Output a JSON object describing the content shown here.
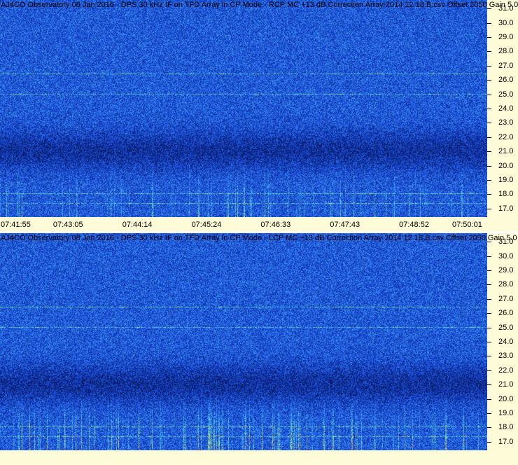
{
  "chart_data": [
    {
      "type": "heatmap",
      "title": "AJ4CO Observatory 08 Jan 2016 - DPS 30 kHz IF on TFD Array in CP Mode - RCP  MC +13 dB  Correction Array 2014 12 18 B.csv  Offset 2050  Gain 5.0",
      "x_tick_labels": [
        "07:41:55",
        "07:43:05",
        "07:44:14",
        "07:45:24",
        "07:46:33",
        "07:47:43",
        "07:48:52",
        "07:50:01"
      ],
      "y_tick_labels": [
        "31.0",
        "30.0",
        "29.0",
        "28.0",
        "27.0",
        "26.0",
        "25.0",
        "24.0",
        "23.0",
        "22.0",
        "21.0",
        "20.0",
        "19.0",
        "18.0",
        "17.0"
      ],
      "ylim": [
        16.4,
        31.6
      ]
    },
    {
      "type": "heatmap",
      "title": "AJ4CO Observatory 08 Jan 2016 - DPS 30 kHz IF on TFD Array in CP Mode - LCP  MC +13 dB  Correction Array 2014 12 18 B.csv  Offset 2050  Gain 5.0",
      "x_tick_labels": [],
      "y_tick_labels": [
        "31.0",
        "30.0",
        "29.0",
        "28.0",
        "27.0",
        "26.0",
        "25.0",
        "24.0",
        "23.0",
        "22.0",
        "21.0",
        "20.0",
        "19.0",
        "18.0",
        "17.0"
      ],
      "ylim": [
        16.4,
        31.6
      ]
    }
  ],
  "colors": {
    "background": "#fefbd8",
    "spectrogram_base": "#1c4fd2"
  }
}
